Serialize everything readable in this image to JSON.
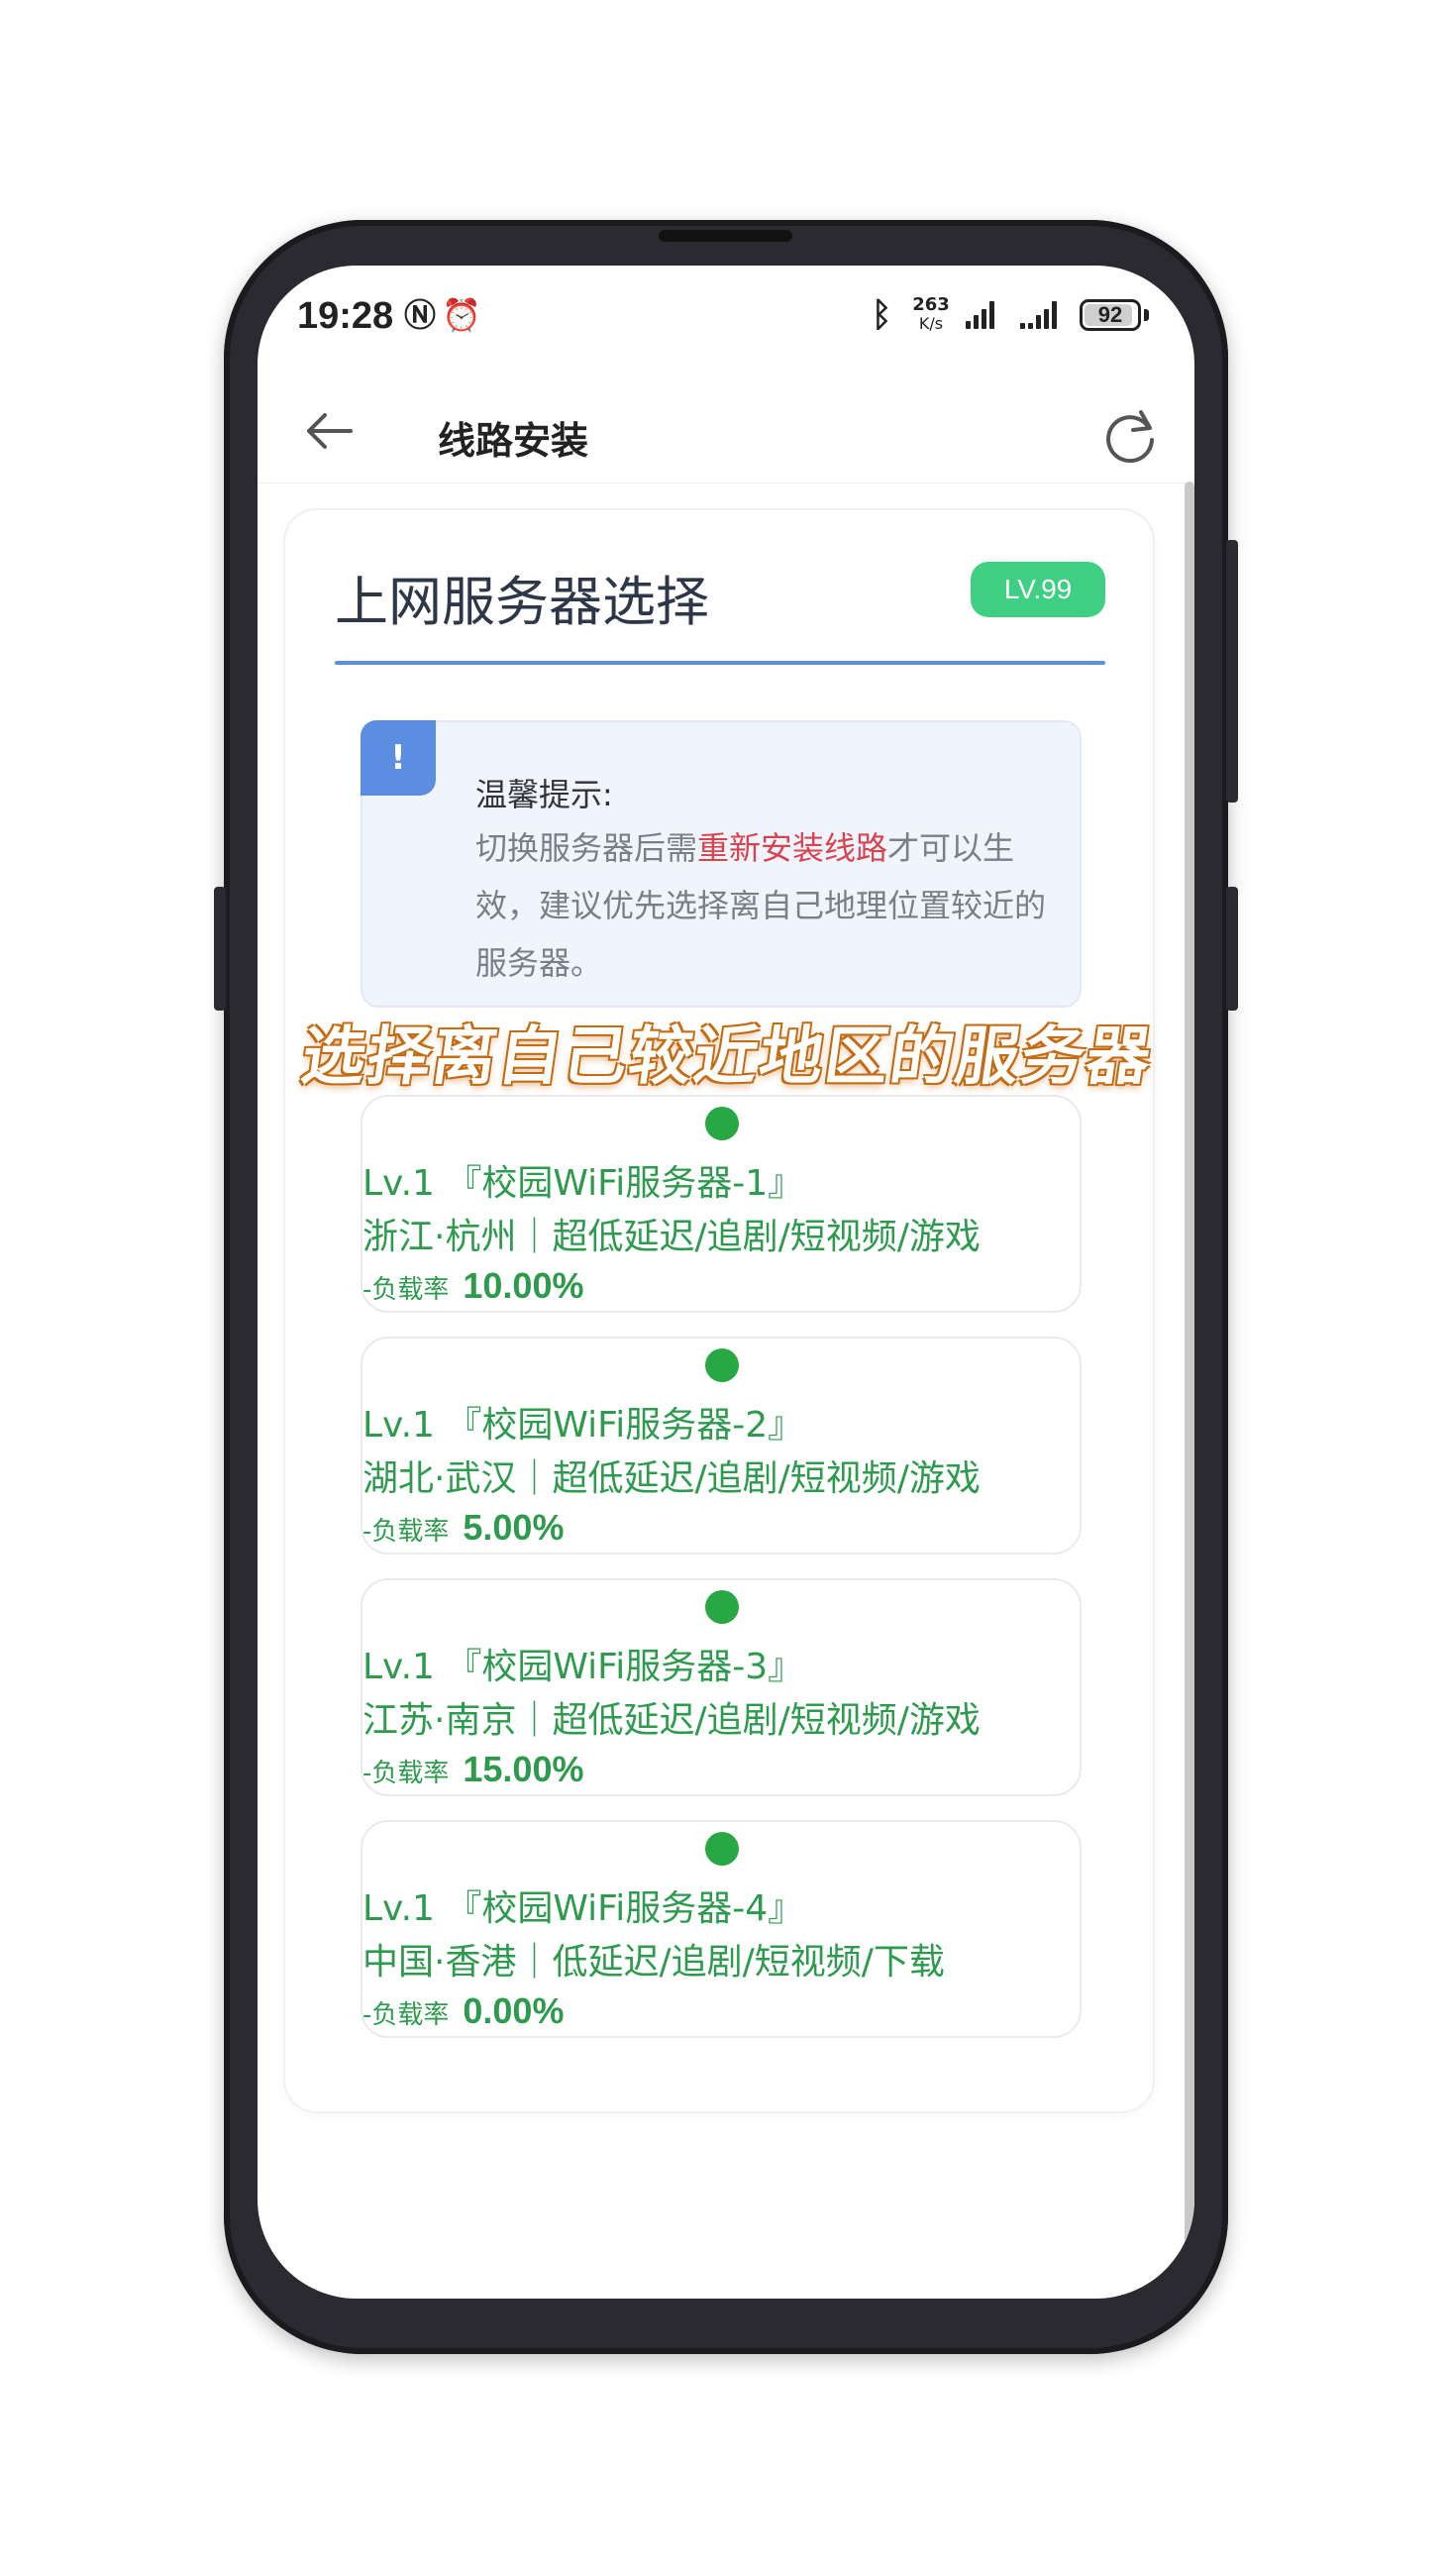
{
  "status_bar": {
    "time": "19:28",
    "network_speed_value": "263",
    "network_speed_unit": "K/s",
    "battery": "92"
  },
  "app_bar": {
    "title": "线路安装"
  },
  "card": {
    "title": "上网服务器选择",
    "level_badge": "LV.99"
  },
  "tip": {
    "icon_symbol": "!",
    "title": "温馨提示:",
    "body_before": "切换服务器后需",
    "body_highlight": "重新安装线路",
    "body_after": "才可以生效，建议优先选择离自己地理位置较近的服务器。"
  },
  "caption_overlay": "选择离自己较近地区的服务器",
  "servers": [
    {
      "name": "Lv.1 『校园WiFi服务器-1』",
      "desc": "浙江·杭州｜超低延迟/追剧/短视频/游戏",
      "load_label": "-负载率",
      "load": "10.00%"
    },
    {
      "name": "Lv.1 『校园WiFi服务器-2』",
      "desc": "湖北·武汉｜超低延迟/追剧/短视频/游戏",
      "load_label": "-负载率",
      "load": "5.00%"
    },
    {
      "name": "Lv.1 『校园WiFi服务器-3』",
      "desc": "江苏·南京｜超低延迟/追剧/短视频/游戏",
      "load_label": "-负载率",
      "load": "15.00%"
    },
    {
      "name": "Lv.1 『校园WiFi服务器-4』",
      "desc": "中国·香港｜低延迟/追剧/短视频/下载",
      "load_label": "-负载率",
      "load": "0.00%"
    }
  ],
  "colors": {
    "accent_blue": "#5b8ee0",
    "badge_green": "#3ecf82",
    "server_green": "#2e9a4e",
    "status_dot": "#28a745",
    "highlight_red": "#d9434e"
  }
}
